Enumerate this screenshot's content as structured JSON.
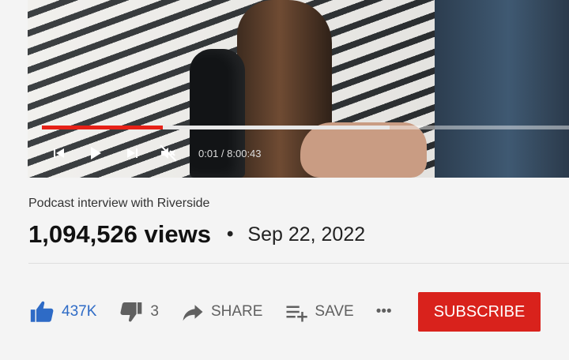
{
  "video": {
    "time_display": "0:01 / 8:00:43",
    "played_fraction": 0.224,
    "buffered_fraction": 0.64
  },
  "meta": {
    "subtitle": "Podcast interview with Riverside",
    "views": "1,094,526 views",
    "separator": "•",
    "date": "Sep 22, 2022"
  },
  "actions": {
    "like_count": "437K",
    "dislike_count": "3",
    "share_label": "SHARE",
    "save_label": "SAVE",
    "more_label": "•••",
    "subscribe_label": "SUBSCRIBE"
  },
  "colors": {
    "accent_blue": "#2e6bc6",
    "subscribe_red": "#d9221c",
    "progress_red": "#e62117"
  },
  "icons": [
    "previous-icon",
    "play-icon",
    "next-icon",
    "muted-icon",
    "thumbs-up-icon",
    "thumbs-down-icon",
    "share-icon",
    "save-icon",
    "more-icon"
  ]
}
